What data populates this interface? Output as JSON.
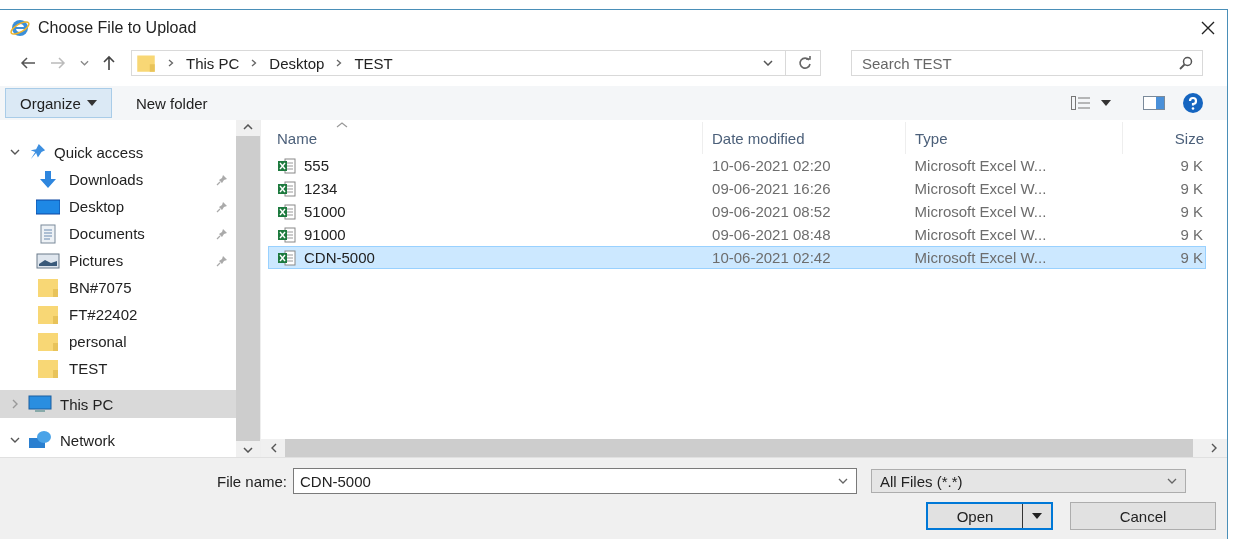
{
  "window": {
    "title": "Choose File to Upload"
  },
  "address": {
    "breadcrumb": [
      "This PC",
      "Desktop",
      "TEST"
    ]
  },
  "search": {
    "placeholder": "Search TEST"
  },
  "toolbar": {
    "organize": "Organize",
    "new_folder": "New folder"
  },
  "sidebar": {
    "items": [
      {
        "label": "Quick access",
        "kind": "quick",
        "expanded": true,
        "selected": false,
        "children": [
          {
            "label": "Downloads",
            "kind": "downloads",
            "pinned": true,
            "selected": false
          },
          {
            "label": "Desktop",
            "kind": "desktop",
            "pinned": true,
            "selected": false
          },
          {
            "label": "Documents",
            "kind": "documents",
            "pinned": true,
            "selected": false
          },
          {
            "label": "Pictures",
            "kind": "pictures",
            "pinned": true,
            "selected": false
          },
          {
            "label": "BN#7075",
            "kind": "folder",
            "pinned": false,
            "selected": false
          },
          {
            "label": "FT#22402",
            "kind": "folder",
            "pinned": false,
            "selected": false
          },
          {
            "label": "personal",
            "kind": "folder",
            "pinned": false,
            "selected": false
          },
          {
            "label": "TEST",
            "kind": "folder",
            "pinned": false,
            "selected": false
          }
        ]
      },
      {
        "label": "This PC",
        "kind": "pc",
        "expanded": false,
        "selected": true
      },
      {
        "label": "Network",
        "kind": "network",
        "expanded": true,
        "selected": false
      }
    ]
  },
  "table": {
    "columns": [
      {
        "label": "Name",
        "sorted": true
      },
      {
        "label": "Date modified",
        "sorted": false
      },
      {
        "label": "Type",
        "sorted": false
      },
      {
        "label": "Size",
        "sorted": false
      }
    ],
    "rows": [
      {
        "name": "555",
        "date": "10-06-2021 02:20",
        "type": "Microsoft Excel W...",
        "size": "9 K",
        "selected": false
      },
      {
        "name": "1234",
        "date": "09-06-2021 16:26",
        "type": "Microsoft Excel W...",
        "size": "9 K",
        "selected": false
      },
      {
        "name": "51000",
        "date": "09-06-2021 08:52",
        "type": "Microsoft Excel W...",
        "size": "9 K",
        "selected": false
      },
      {
        "name": "91000",
        "date": "09-06-2021 08:48",
        "type": "Microsoft Excel W...",
        "size": "9 K",
        "selected": false
      },
      {
        "name": "CDN-5000",
        "date": "10-06-2021 02:42",
        "type": "Microsoft Excel W...",
        "size": "9 K",
        "selected": true
      }
    ]
  },
  "footer": {
    "file_name_label": "File name:",
    "file_name": "CDN-5000",
    "filter": "All Files (*.*)",
    "open": "Open",
    "cancel": "Cancel"
  }
}
